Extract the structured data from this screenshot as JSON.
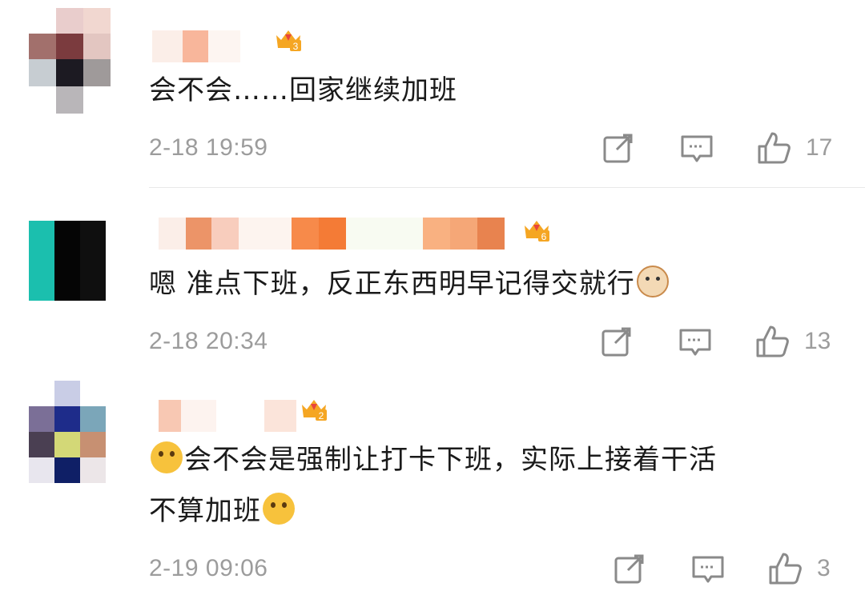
{
  "comments": [
    {
      "text": "会不会……回家继续加班",
      "text_line2": "",
      "emoji_end": "",
      "emoji_start": "",
      "time": "2-18 19:59",
      "likes": "17",
      "level_badge": "3"
    },
    {
      "text": "嗯 准点下班，反正东西明早记得交就行",
      "text_line2": "",
      "emoji_end": "cat-face-emoji",
      "emoji_start": "",
      "time": "2-18 20:34",
      "likes": "13",
      "level_badge": "6"
    },
    {
      "text": "会不会是强制让打卡下班，实际上接着干活",
      "text_line2": "不算加班",
      "emoji_end": "thinking-face-emoji",
      "emoji_start": "thinking-face-emoji",
      "time": "2-19 09:06",
      "likes": "3",
      "level_badge": "2"
    }
  ],
  "icons": {
    "share": "share-icon",
    "reply": "comment-icon",
    "like": "thumbs-up-icon"
  },
  "colors": {
    "text": "#1a1a1a",
    "meta": "#9c9c9c",
    "crown": "#f5a623",
    "gem": "#e8453c"
  }
}
